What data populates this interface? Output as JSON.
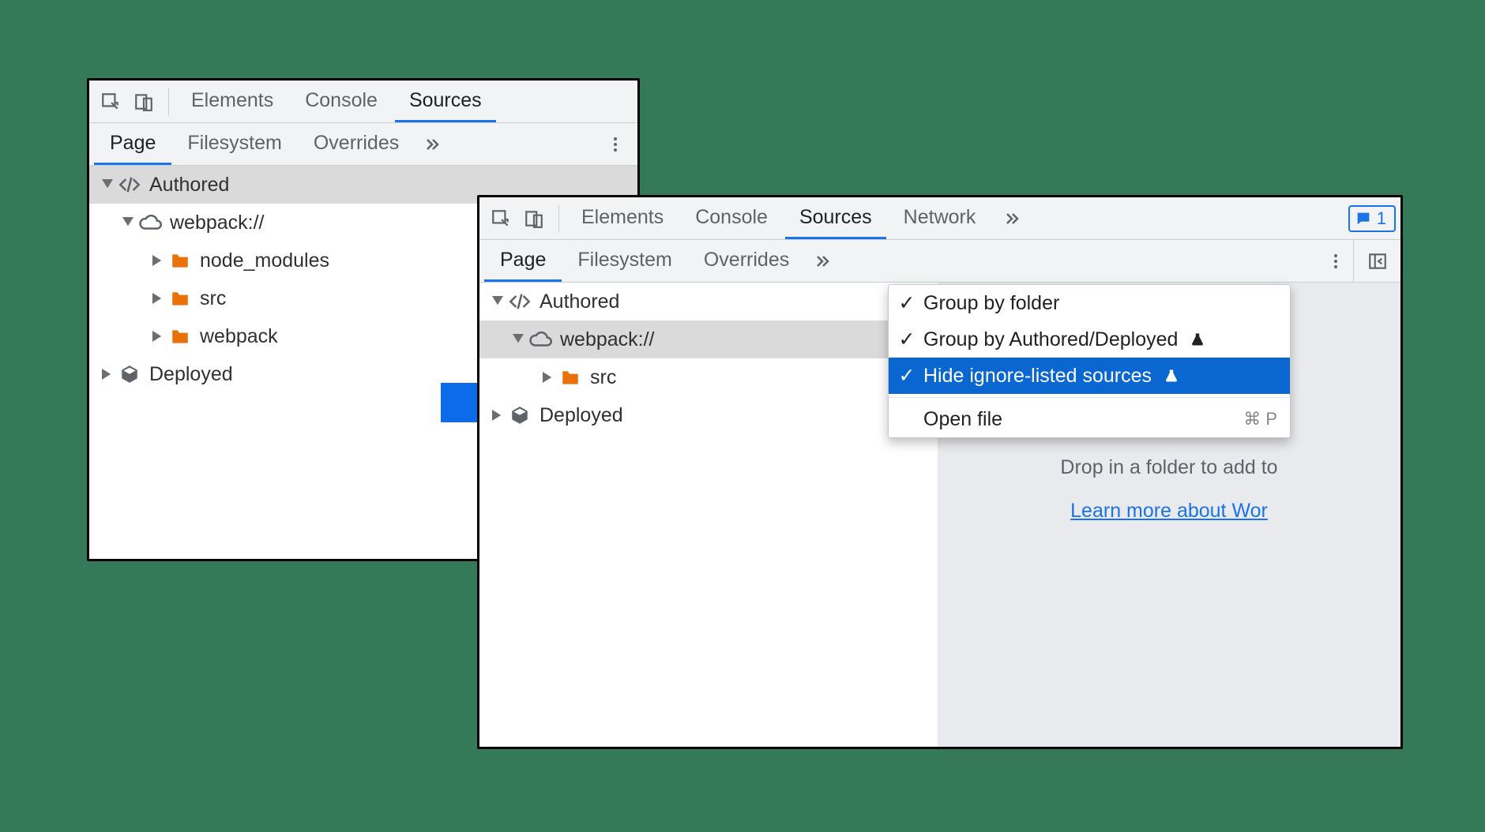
{
  "panelA": {
    "main_tabs": [
      "Elements",
      "Console",
      "Sources"
    ],
    "main_active": 2,
    "sub_tabs": [
      "Page",
      "Filesystem",
      "Overrides"
    ],
    "sub_active": 0,
    "tree": {
      "authored": "Authored",
      "webpack": "webpack://",
      "node_modules": "node_modules",
      "src": "src",
      "webpack_folder": "webpack",
      "deployed": "Deployed"
    }
  },
  "panelB": {
    "main_tabs": [
      "Elements",
      "Console",
      "Sources",
      "Network"
    ],
    "main_active": 2,
    "feedback_count": "1",
    "sub_tabs": [
      "Page",
      "Filesystem",
      "Overrides"
    ],
    "sub_active": 0,
    "tree": {
      "authored": "Authored",
      "webpack": "webpack://",
      "src": "src",
      "deployed": "Deployed"
    },
    "popup": {
      "group_folder": "Group by folder",
      "group_authored": "Group by Authored/Deployed",
      "hide_ignore": "Hide ignore-listed sources",
      "open_file": "Open file",
      "open_file_shortcut": "⌘ P"
    },
    "secondary": {
      "drop_text": "Drop in a folder to add to",
      "learn_more": "Learn more about Wor"
    }
  }
}
